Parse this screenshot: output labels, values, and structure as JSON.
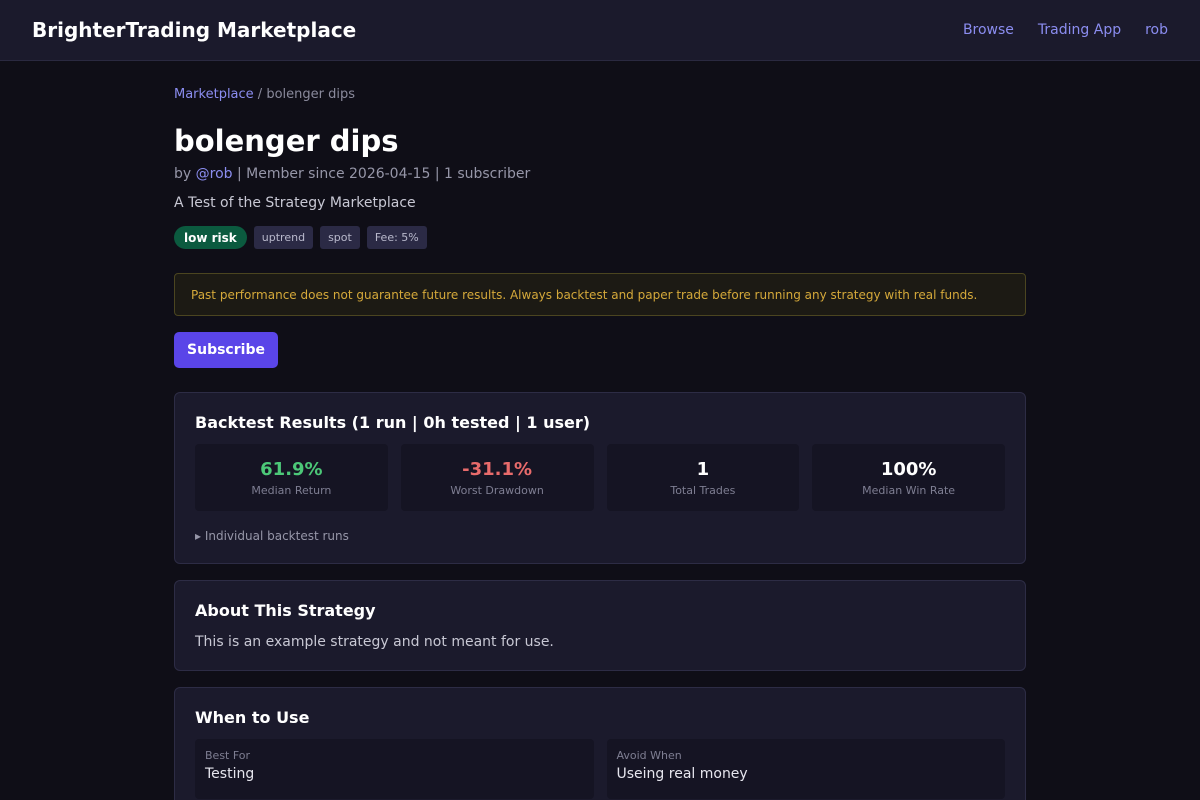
{
  "header": {
    "brand": "BrighterTrading Marketplace",
    "nav": [
      "Browse",
      "Trading App",
      "rob"
    ]
  },
  "breadcrumb": {
    "root": "Marketplace",
    "separator": " / ",
    "current": "bolenger dips"
  },
  "strategy": {
    "title": "bolenger dips",
    "by_prefix": "by ",
    "author": "@rob",
    "meta_rest": " | Member since 2026-04-15 | 1 subscriber",
    "description": "A Test of the Strategy Marketplace",
    "tags": {
      "risk": "low risk",
      "trend": "uptrend",
      "market": "spot",
      "fee": "Fee: 5%"
    }
  },
  "warning": "Past performance does not guarantee future results. Always backtest and paper trade before running any strategy with real funds.",
  "subscribe_label": "Subscribe",
  "backtest": {
    "title": "Backtest Results (1 run | 0h tested | 1 user)",
    "stats": [
      {
        "value": "61.9%",
        "label": "Median Return",
        "color": "#4cc878"
      },
      {
        "value": "-31.1%",
        "label": "Worst Drawdown",
        "color": "#e86b6b"
      },
      {
        "value": "1",
        "label": "Total Trades",
        "color": "#ffffff"
      },
      {
        "value": "100%",
        "label": "Median Win Rate",
        "color": "#ffffff"
      }
    ],
    "runs_toggle": "▸ Individual backtest runs"
  },
  "about": {
    "title": "About This Strategy",
    "text": "This is an example strategy and not meant for use."
  },
  "when": {
    "title": "When to Use",
    "best_label": "Best For",
    "best_value": "Testing",
    "avoid_label": "Avoid When",
    "avoid_value": "Useing real money"
  }
}
